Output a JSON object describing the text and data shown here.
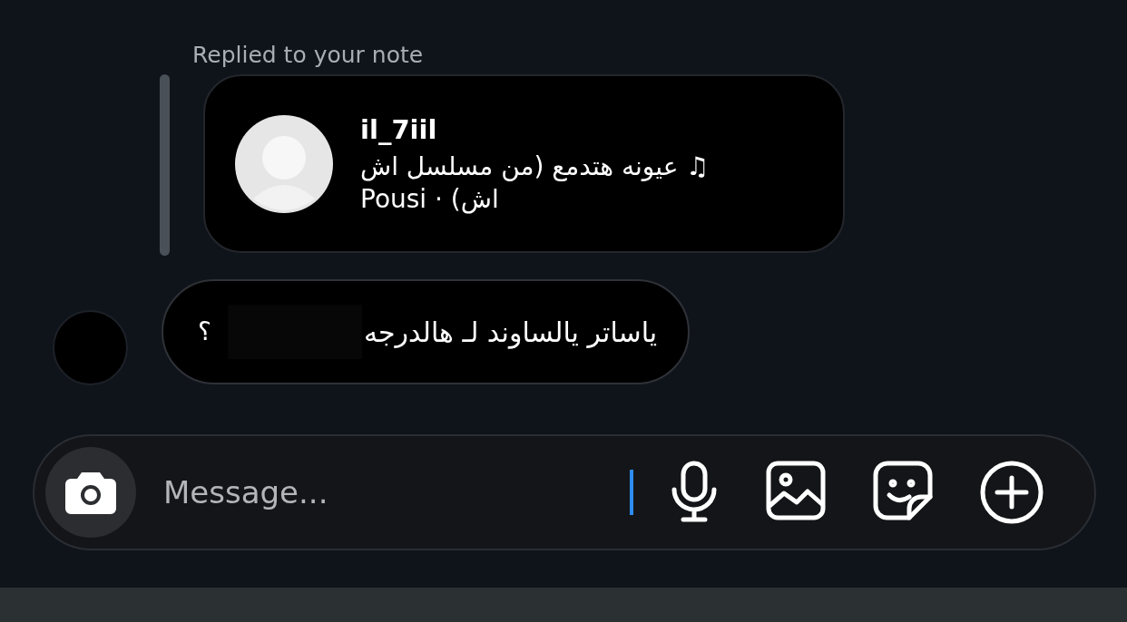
{
  "reply_label": "Replied to your note",
  "note": {
    "username": "il_7iil",
    "text": "♫ عيونه هتدمع (من مسلسل اش اش) · Pousi"
  },
  "message": {
    "text": "ياساتر يالساوند لـ هالدرجه",
    "end": "؟",
    "redacted": true
  },
  "composer": {
    "placeholder": "Message...",
    "focused": true
  }
}
